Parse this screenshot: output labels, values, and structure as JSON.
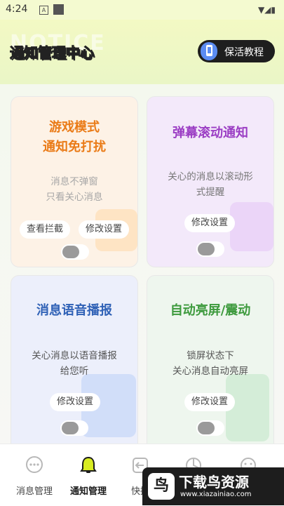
{
  "status_bar": {
    "time": "4:24"
  },
  "header": {
    "watermark_text": "NOTICE",
    "title": "通知管理中心",
    "tutorial_button": "保活教程"
  },
  "cards": [
    {
      "title_lines": [
        "游戏模式",
        "通知免打扰"
      ],
      "description_lines": [
        "消息不弹窗",
        "只看关心消息"
      ],
      "buttons": [
        "查看拦截",
        "修改设置"
      ],
      "toggle_on": false,
      "title_color": "#ea7b17"
    },
    {
      "title_lines": [
        "弹幕滚动通知"
      ],
      "description_lines": [
        "关心的消息以滚动形",
        "式提醒"
      ],
      "buttons": [
        "修改设置"
      ],
      "toggle_on": false,
      "title_color": "#9b3ec4"
    },
    {
      "title_lines": [
        "消息语音播报"
      ],
      "description_lines": [
        "关心消息以语音播报",
        "给您听"
      ],
      "buttons": [
        "修改设置"
      ],
      "toggle_on": false,
      "title_color": "#2f61b6"
    },
    {
      "title_lines": [
        "自动亮屏/震动"
      ],
      "description_lines": [
        "锁屏状态下",
        "关心消息自动亮屏"
      ],
      "buttons": [
        "修改设置"
      ],
      "toggle_on": false,
      "title_color": "#3d9a3d"
    }
  ],
  "tabs": [
    {
      "label": "消息管理",
      "icon": "chat-bubble-icon",
      "active": false
    },
    {
      "label": "通知管理",
      "icon": "bell-icon",
      "active": true
    },
    {
      "label": "快捷",
      "icon": "reply-icon",
      "active": false
    },
    {
      "label": "",
      "icon": "pie-chart-icon",
      "active": false
    },
    {
      "label": "",
      "icon": "face-icon",
      "active": false
    }
  ],
  "watermark": {
    "brand": "下载鸟资源",
    "url": "www.xiazainiao.com"
  },
  "colors": {
    "active_tab": "#1c1c1c",
    "active_tab_icon": "#d8ec22",
    "title_yellow": "#f4e21a"
  }
}
